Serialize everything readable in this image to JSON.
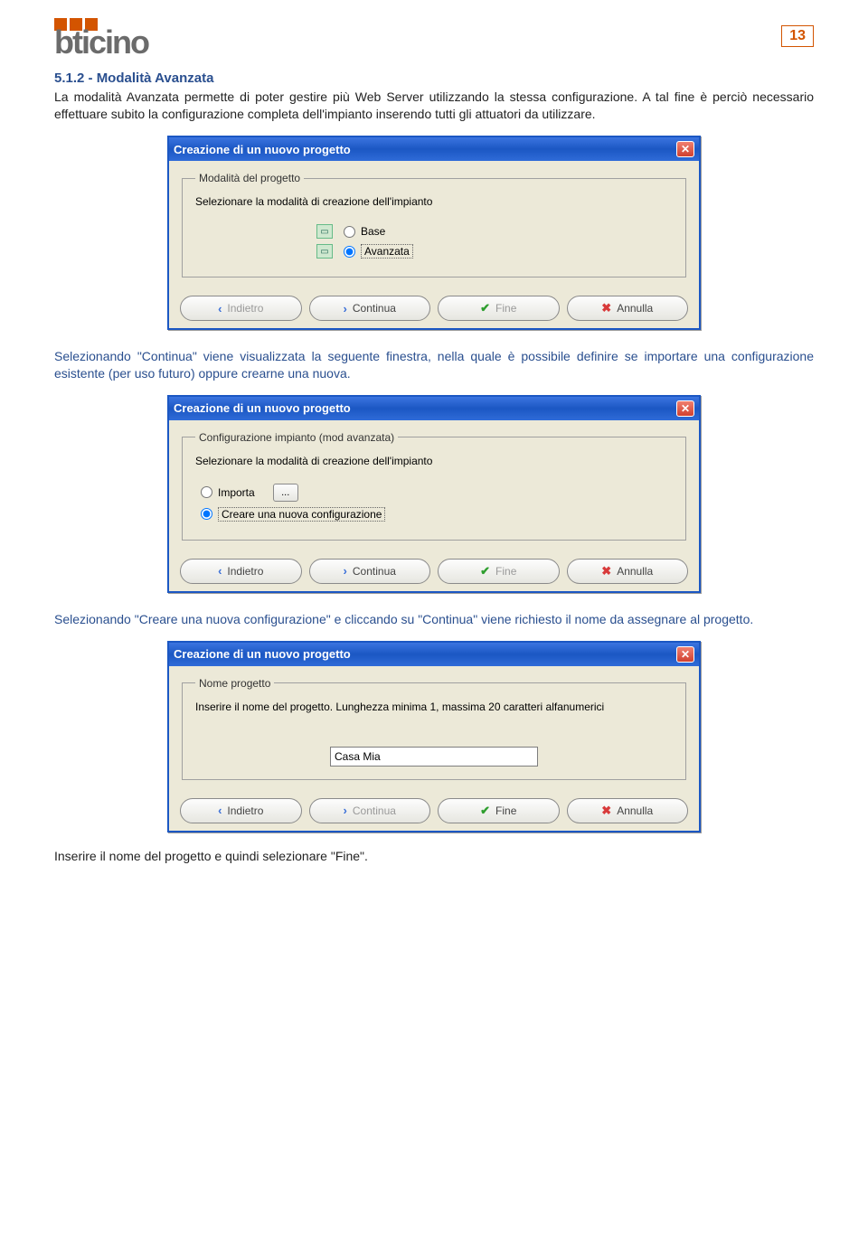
{
  "page_number": "13",
  "logo_text": "bticino",
  "section": {
    "heading": "5.1.2 - Modalità Avanzata",
    "p1": "La modalità Avanzata permette di poter gestire più Web Server utilizzando la stessa configurazione. A tal fine è perciò necessario effettuare subito la configurazione completa dell'impianto inserendo tutti gli attuatori da utilizzare.",
    "p2": "Selezionando \"Continua\" viene visualizzata la seguente finestra, nella quale è possibile definire se importare una configurazione esistente (per uso futuro) oppure crearne una nuova.",
    "p3": "Selezionando \"Creare una nuova configurazione\" e cliccando su \"Continua\" viene richiesto il nome da assegnare al progetto.",
    "pfinal": "Inserire il nome del progetto e quindi selezionare \"Fine\"."
  },
  "dialog1": {
    "title": "Creazione di un nuovo progetto",
    "group": "Modalità del progetto",
    "instr": "Selezionare la modalità di creazione dell'impianto",
    "opt_base": "Base",
    "opt_adv": "Avanzata",
    "selected": "avanzata",
    "btn_back": "Indietro",
    "btn_next": "Continua",
    "btn_end": "Fine",
    "btn_cancel": "Annulla"
  },
  "dialog2": {
    "title": "Creazione di un nuovo progetto",
    "group": "Configurazione impianto (mod avanzata)",
    "instr": "Selezionare la modalità di creazione dell'impianto",
    "opt_import": "Importa",
    "opt_new": "Creare una nuova configurazione",
    "browse": "...",
    "selected": "new",
    "btn_back": "Indietro",
    "btn_next": "Continua",
    "btn_end": "Fine",
    "btn_cancel": "Annulla"
  },
  "dialog3": {
    "title": "Creazione di un nuovo progetto",
    "group": "Nome progetto",
    "instr": "Inserire il nome del progetto. Lunghezza minima 1, massima 20 caratteri alfanumerici",
    "value": "Casa Mia",
    "btn_back": "Indietro",
    "btn_next": "Continua",
    "btn_end": "Fine",
    "btn_cancel": "Annulla"
  }
}
